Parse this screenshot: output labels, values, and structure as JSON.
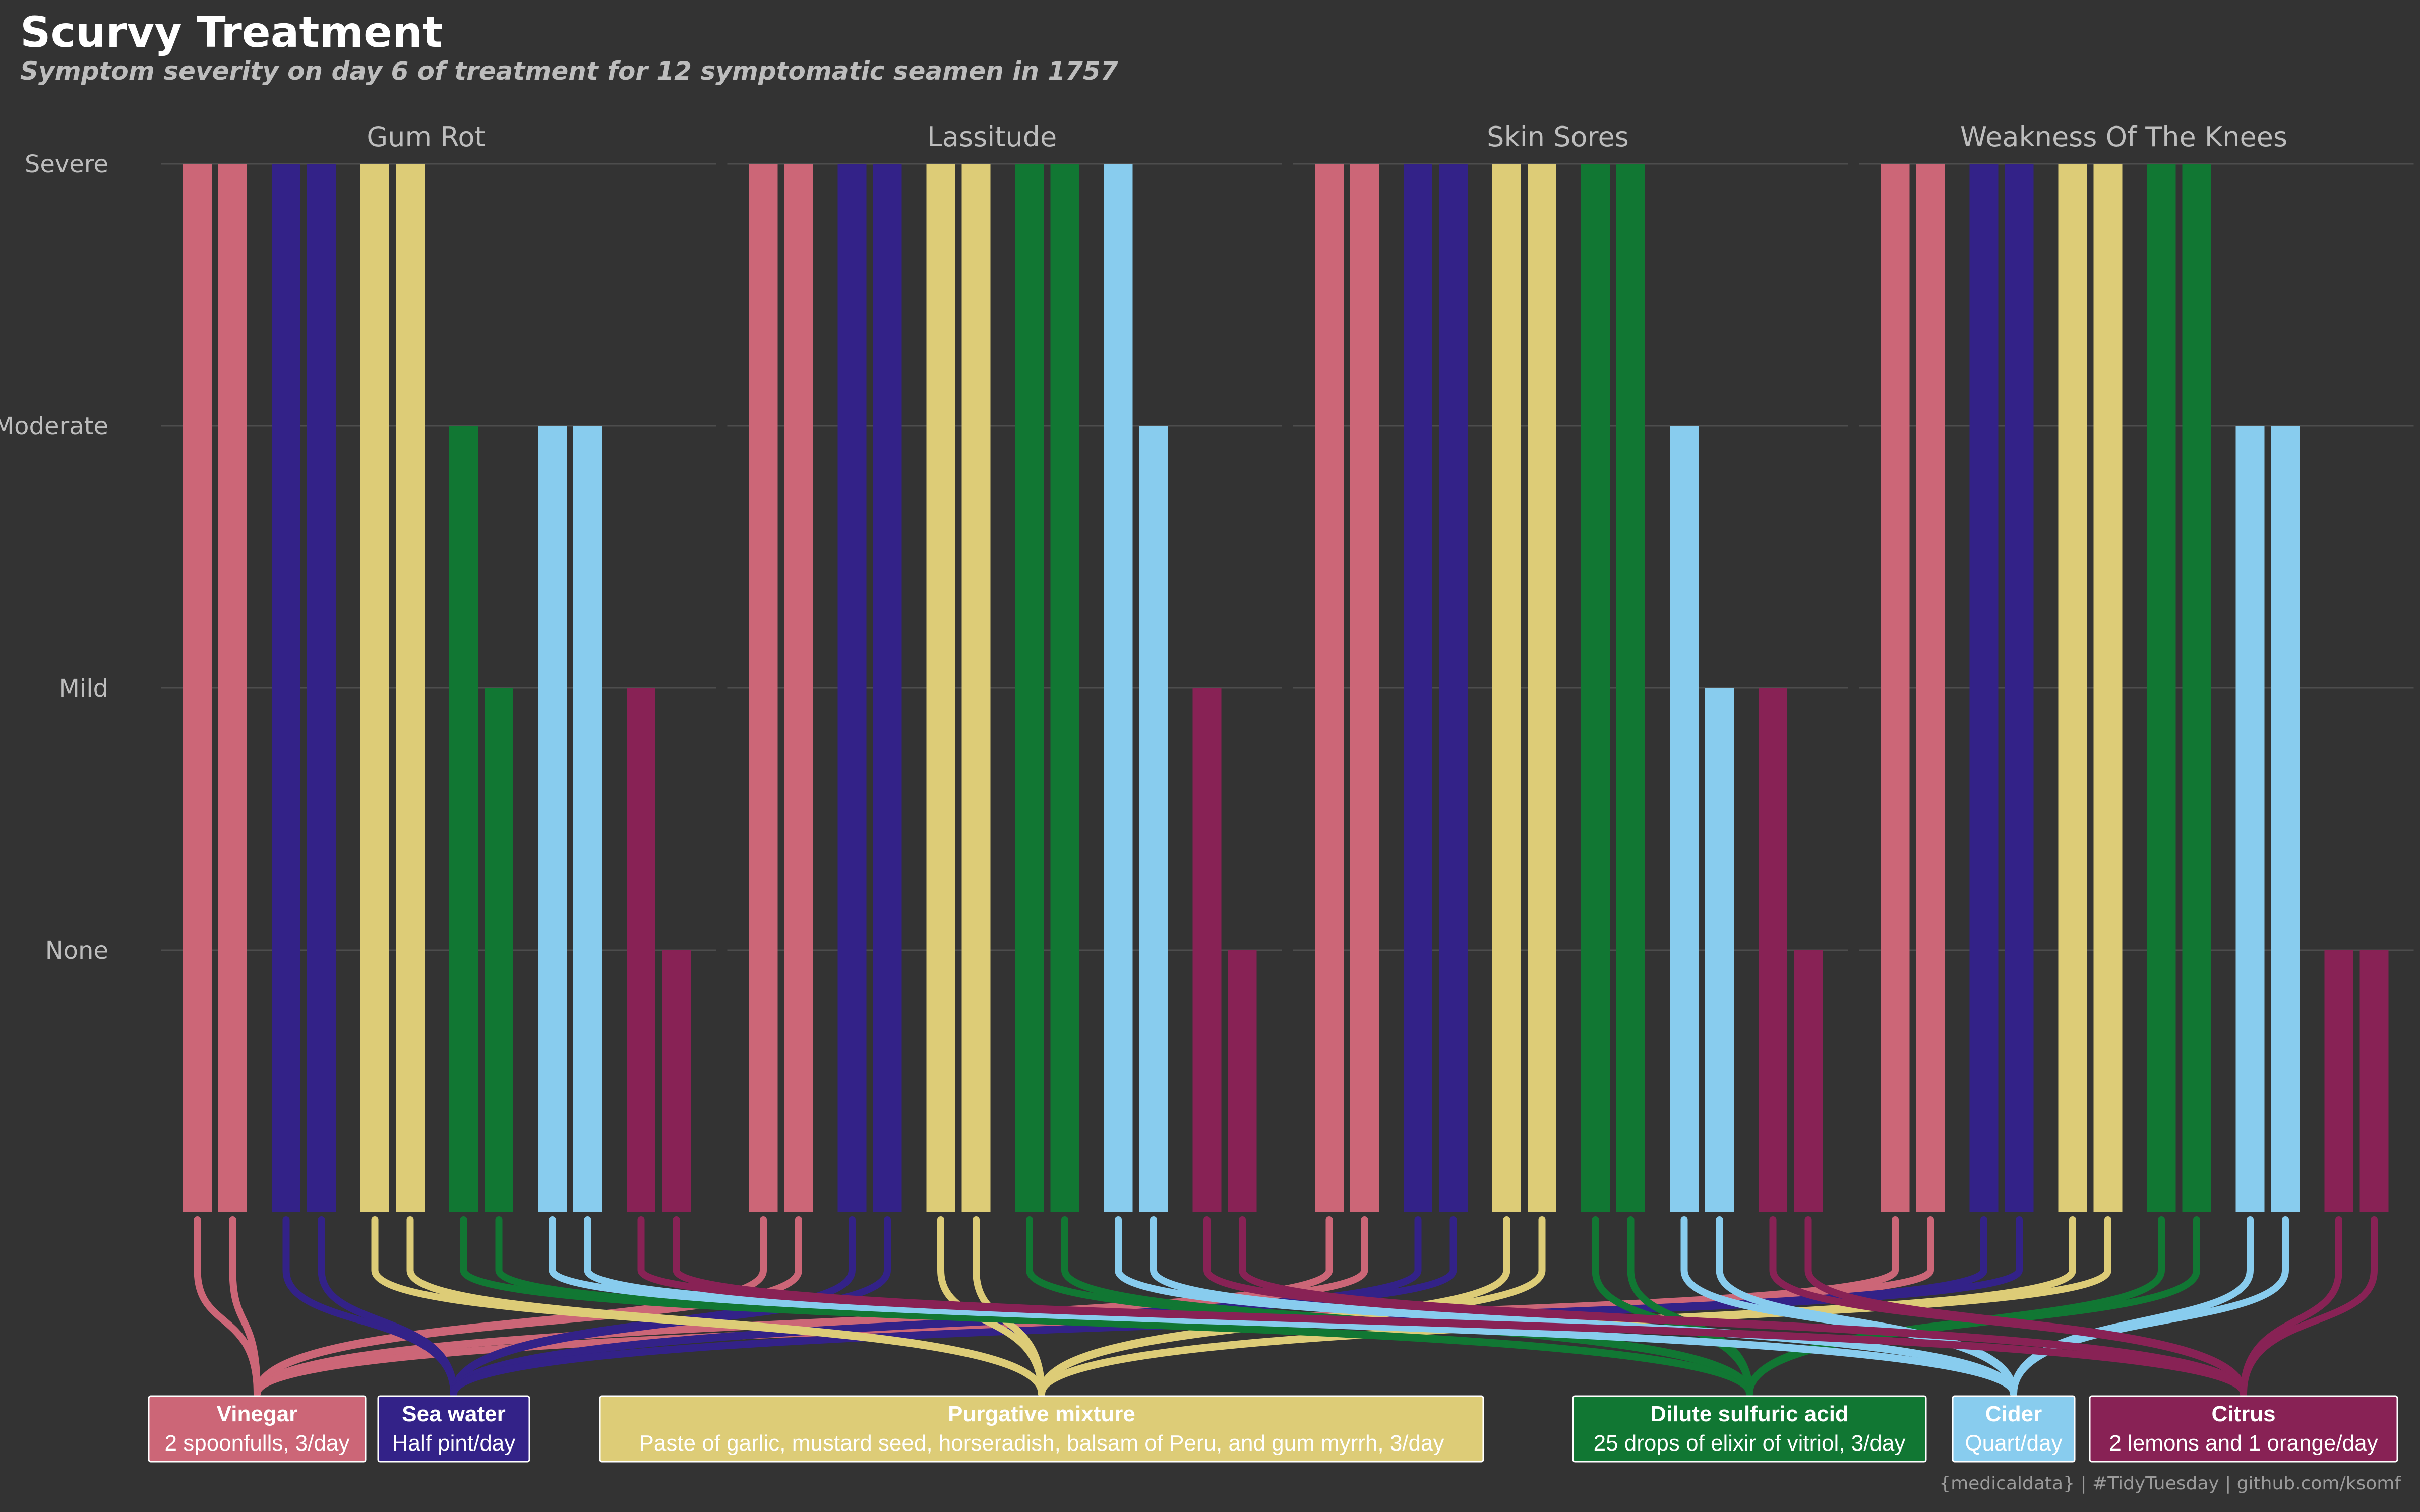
{
  "header": {
    "title": "Scurvy Treatment",
    "subtitle": "Symptom severity on day 6 of treatment for 12 symptomatic seamen in 1757"
  },
  "caption": "{medicaldata} | #TidyTuesday | github.com/ksomf",
  "chart_data": {
    "type": "bar",
    "y_levels": [
      "None",
      "Mild",
      "Moderate",
      "Severe"
    ],
    "panels": [
      {
        "name": "Gum Rot",
        "values": [
          3,
          3,
          3,
          3,
          3,
          3,
          2,
          1,
          2,
          2,
          1,
          0
        ]
      },
      {
        "name": "Lassitude",
        "values": [
          3,
          3,
          3,
          3,
          3,
          3,
          3,
          3,
          3,
          2,
          1,
          0
        ]
      },
      {
        "name": "Skin Sores",
        "values": [
          3,
          3,
          3,
          3,
          3,
          3,
          3,
          3,
          2,
          1,
          1,
          0
        ]
      },
      {
        "name": "Weakness Of The Knees",
        "values": [
          3,
          3,
          3,
          3,
          3,
          3,
          3,
          3,
          2,
          2,
          0,
          0
        ]
      }
    ],
    "treatments": [
      {
        "name": "Vinegar",
        "dose": "2 spoonfulls, 3/day",
        "color": "#CC6677"
      },
      {
        "name": "Sea water",
        "dose": "Half pint/day",
        "color": "#332288"
      },
      {
        "name": "Purgative mixture",
        "dose": "Paste of garlic, mustard seed, horseradish, balsam of Peru, and gum myrrh, 3/day",
        "color": "#DDCC77"
      },
      {
        "name": "Dilute sulfuric acid",
        "dose": "25 drops of elixir of vitriol, 3/day",
        "color": "#117733"
      },
      {
        "name": "Cider",
        "dose": "Quart/day",
        "color": "#88CCEE"
      },
      {
        "name": "Citrus",
        "dose": "2 lemons and 1 orange/day",
        "color": "#882255"
      }
    ],
    "grid": true,
    "colors": {
      "background": "#333333",
      "grid": "#4d4d4d",
      "axis_text": "#bdbdbd",
      "title": "#ffffff",
      "subtitle": "#bdbdbd"
    }
  }
}
